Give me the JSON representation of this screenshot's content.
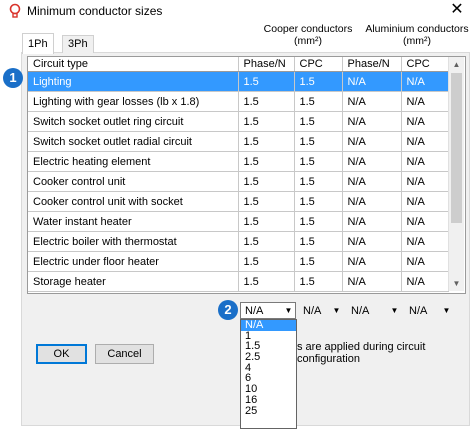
{
  "window": {
    "title": "Minimum conductor sizes",
    "close_glyph": "✕",
    "icon": "bulb-icon"
  },
  "headers": {
    "copper": "Cooper conductors\n(mm²)",
    "aluminium": "Aluminium conductors\n(mm²)"
  },
  "tabs": [
    {
      "label": "1Ph",
      "active": true
    },
    {
      "label": "3Ph",
      "active": false
    }
  ],
  "table": {
    "columns": [
      "Circuit type",
      "Phase/N",
      "CPC",
      "Phase/N",
      "CPC"
    ],
    "rows": [
      [
        "Lighting",
        "1.5",
        "1.5",
        "N/A",
        "N/A"
      ],
      [
        "Lighting with gear losses (lb x 1.8)",
        "1.5",
        "1.5",
        "N/A",
        "N/A"
      ],
      [
        "Switch socket outlet ring circuit",
        "1.5",
        "1.5",
        "N/A",
        "N/A"
      ],
      [
        "Switch socket outlet radial circuit",
        "1.5",
        "1.5",
        "N/A",
        "N/A"
      ],
      [
        "Electric heating element",
        "1.5",
        "1.5",
        "N/A",
        "N/A"
      ],
      [
        "Cooker control unit",
        "1.5",
        "1.5",
        "N/A",
        "N/A"
      ],
      [
        "Cooker control unit with socket",
        "1.5",
        "1.5",
        "N/A",
        "N/A"
      ],
      [
        "Water instant heater",
        "1.5",
        "1.5",
        "N/A",
        "N/A"
      ],
      [
        "Electric boiler with thermostat",
        "1.5",
        "1.5",
        "N/A",
        "N/A"
      ],
      [
        "Electric under floor heater",
        "1.5",
        "1.5",
        "N/A",
        "N/A"
      ],
      [
        "Storage heater",
        "1.5",
        "1.5",
        "N/A",
        "N/A"
      ]
    ],
    "selected_row": 0
  },
  "badges": {
    "one": "1",
    "two": "2"
  },
  "combos": [
    "N/A",
    "N/A",
    "N/A",
    "N/A"
  ],
  "dropdown_options": [
    "N/A",
    "1",
    "1.5",
    "2.5",
    "4",
    "6",
    "10",
    "16",
    "25"
  ],
  "note": "s are applied during circuit configuration",
  "buttons": {
    "ok": "OK",
    "cancel": "Cancel"
  },
  "colors": {
    "selection": "#3399ff",
    "badge": "#1a6fc8"
  }
}
